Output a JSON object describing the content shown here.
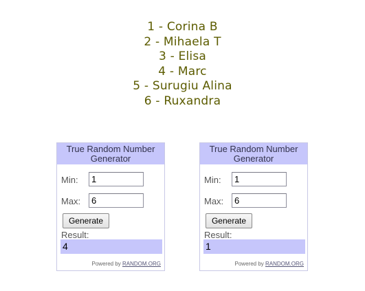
{
  "names": [
    "1 - Corina B",
    "2 - Mihaela T",
    "3 - Elisa",
    "4 - Marc",
    "5 - Surugiu Alina",
    "6 - Ruxandra"
  ],
  "widgets": [
    {
      "title": "True Random Number Generator",
      "min_label": "Min:",
      "min_value": "1",
      "max_label": "Max:",
      "max_value": "6",
      "generate_label": "Generate",
      "result_label": "Result:",
      "result_value": "4",
      "powered_by": "Powered by",
      "powered_link": "RANDOM.ORG"
    },
    {
      "title": "True Random Number Generator",
      "min_label": "Min:",
      "min_value": "1",
      "max_label": "Max:",
      "max_value": "6",
      "generate_label": "Generate",
      "result_label": "Result:",
      "result_value": "1",
      "powered_by": "Powered by",
      "powered_link": "RANDOM.ORG"
    }
  ],
  "colors": {
    "name_text": "#5c5c00",
    "widget_header_bg": "#c6c6fb",
    "result_bg": "#c6c6fb",
    "widget_border": "#c8c8e6"
  }
}
